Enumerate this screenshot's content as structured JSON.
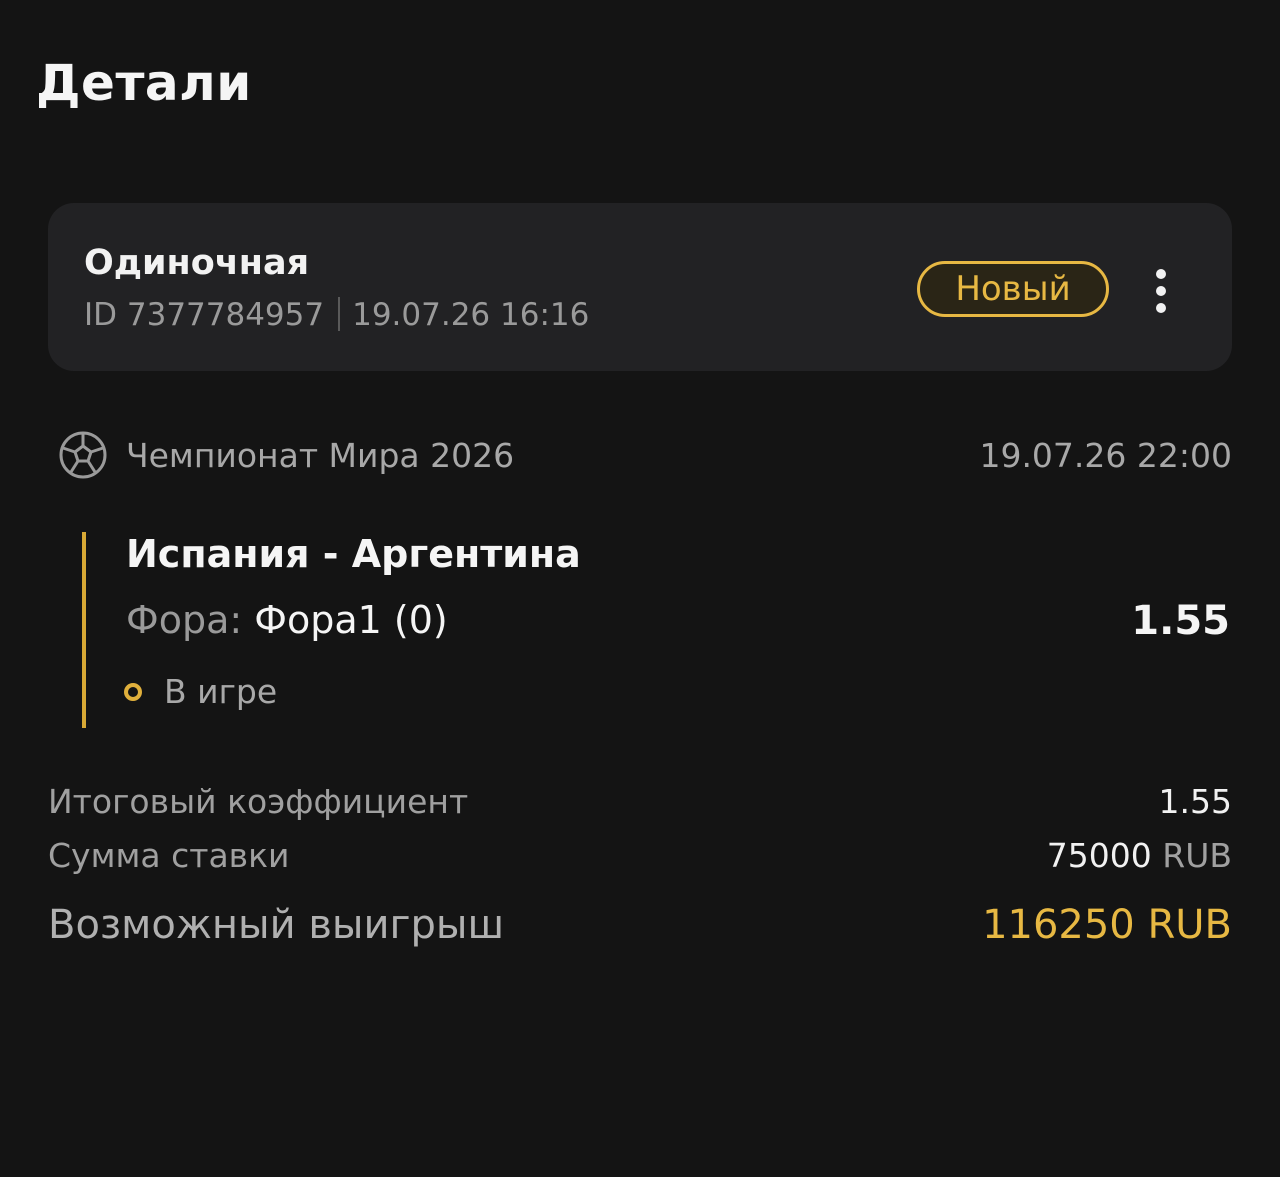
{
  "page": {
    "title": "Детали"
  },
  "bet": {
    "type": "Одиночная",
    "id_label": "ID 7377784957",
    "created": "19.07.26 16:16",
    "status": "Новый",
    "menu_icon": "more-vertical-icon"
  },
  "event": {
    "sport_icon": "soccer-ball-icon",
    "tournament": "Чемпионат Мира 2026",
    "start": "19.07.26 22:00",
    "match": "Испания - Аргентина",
    "market_label": "Фора:",
    "market_value": "Фора1 (0)",
    "odds": "1.55",
    "state": "В игре",
    "accent_color": "#d9a935"
  },
  "summary": {
    "total_odds_label": "Итоговый коэффициент",
    "total_odds": "1.55",
    "stake_label": "Сумма ставки",
    "stake_amount": "75000",
    "stake_currency": "RUB",
    "win_label": "Возможный выигрыш",
    "win_amount": "116250",
    "win_currency": "RUB",
    "highlight_color": "#e7b843"
  }
}
